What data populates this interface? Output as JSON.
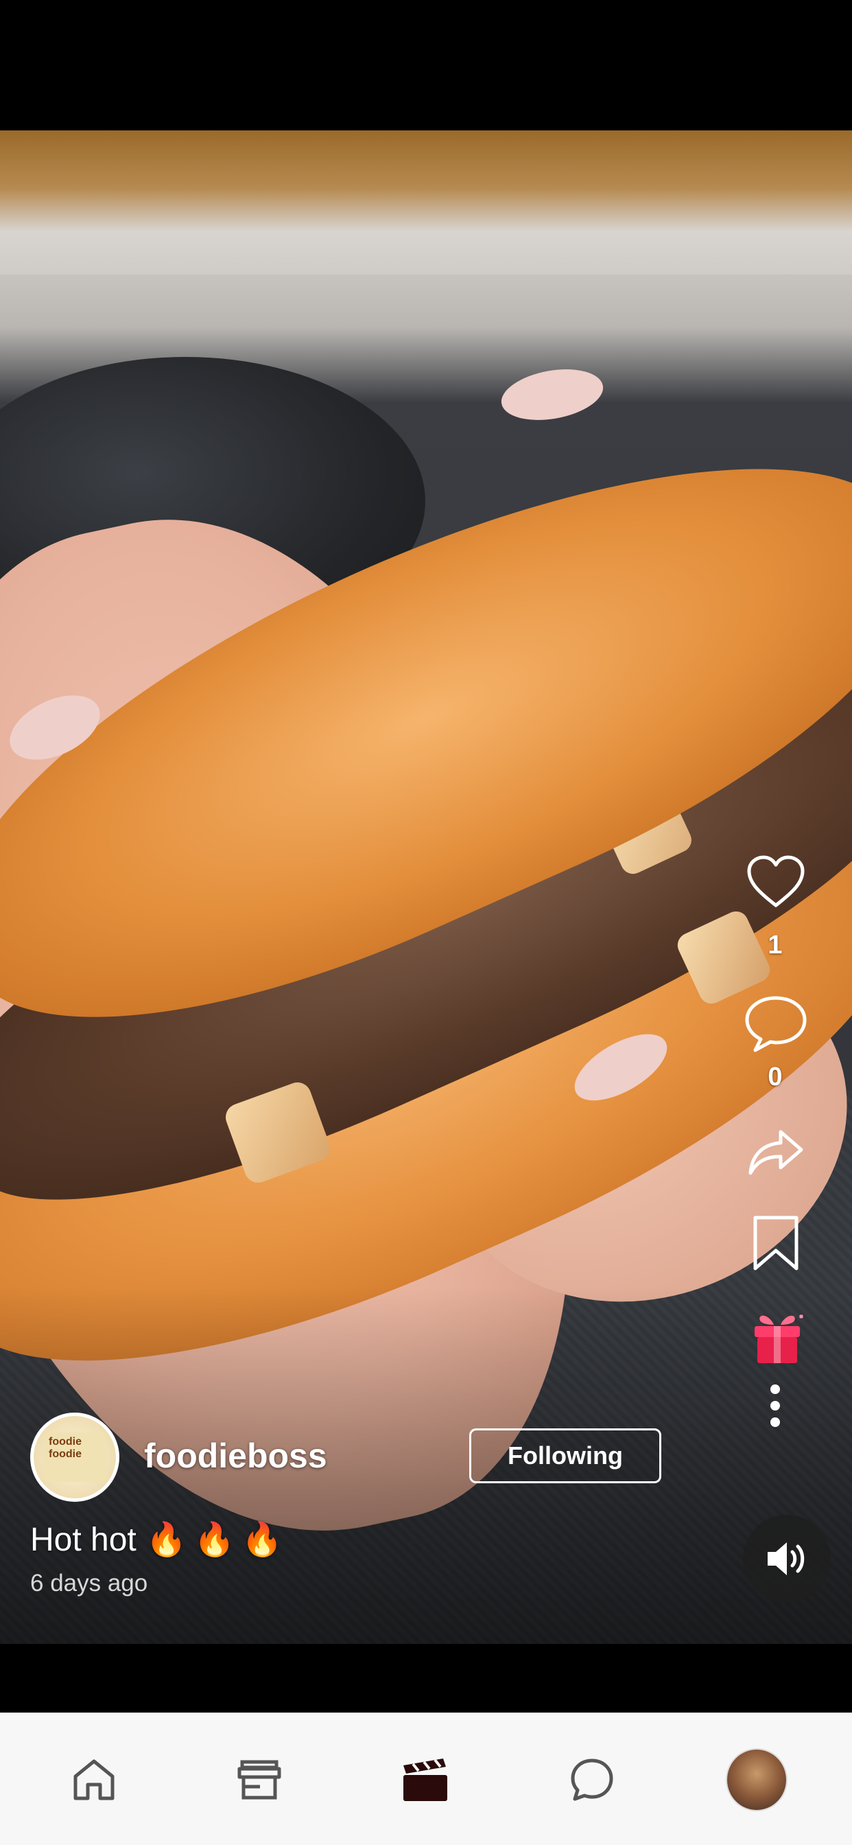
{
  "post": {
    "username": "foodieboss",
    "follow_label": "Following",
    "caption": "Hot hot",
    "caption_emoji": "🔥🔥🔥",
    "time_ago": "6 days ago",
    "avatar_text": [
      "foodie",
      "foodie"
    ]
  },
  "actions": {
    "likes": "1",
    "comments": "0",
    "icons": [
      "heart-icon",
      "comment-icon",
      "share-icon",
      "bookmark-icon",
      "gift-icon",
      "more-icon",
      "volume-icon"
    ]
  },
  "nav": {
    "items": [
      "home-icon",
      "store-icon",
      "video-icon",
      "chat-icon",
      "profile-avatar"
    ],
    "active": "video-icon"
  },
  "colors": {
    "accent": "#e8214a",
    "nav_active": "#2a0a0a",
    "nav_inactive": "#555555"
  }
}
